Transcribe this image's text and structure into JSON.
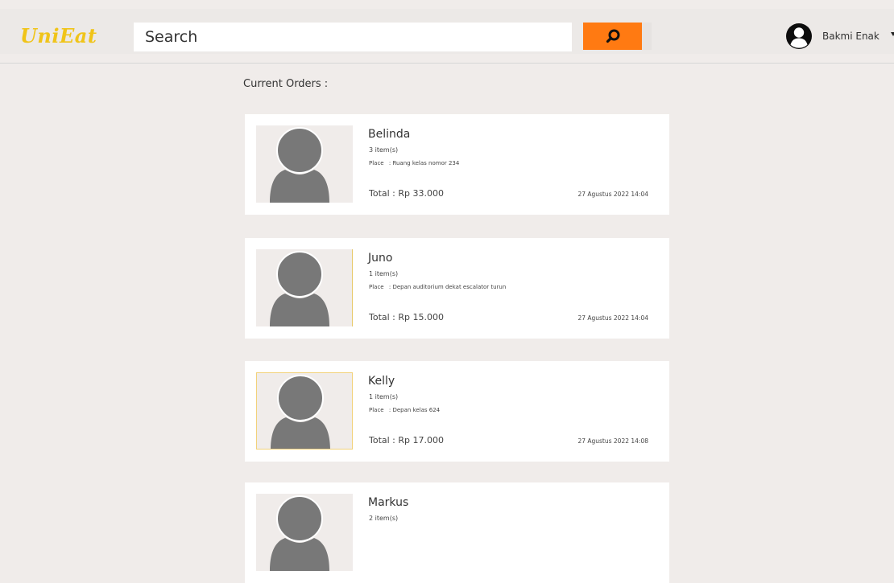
{
  "header": {
    "logo": "UniEat",
    "search_placeholder": "Search",
    "user_name": "Bakmi Enak"
  },
  "main": {
    "section_title": "Current Orders :",
    "place_label": "Place",
    "total_label": "Total :",
    "orders": [
      {
        "name": "Belinda",
        "items": "3 item(s)",
        "place": ": Ruang kelas nomor 234",
        "total": "Rp 33.000",
        "datetime": "27 Agustus 2022 14:04"
      },
      {
        "name": "Juno",
        "items": "1 item(s)",
        "place": ": Depan auditorium dekat escalator turun",
        "total": "Rp 15.000",
        "datetime": "27 Agustus 2022 14:04"
      },
      {
        "name": "Kelly",
        "items": "1 item(s)",
        "place": ": Depan kelas 624",
        "total": "Rp 17.000",
        "datetime": "27 Agustus 2022 14:08"
      },
      {
        "name": "Markus",
        "items": "2 item(s)"
      }
    ]
  },
  "colors": {
    "brand": "#f0c419",
    "accent": "#ff7a12",
    "background": "#f0ecea",
    "placeholder_avatar": "#787878"
  },
  "icons": {
    "search": "search-icon",
    "user": "user-avatar-icon",
    "dropdown": "chevron-down-icon",
    "placeholder": "person-placeholder-icon"
  }
}
